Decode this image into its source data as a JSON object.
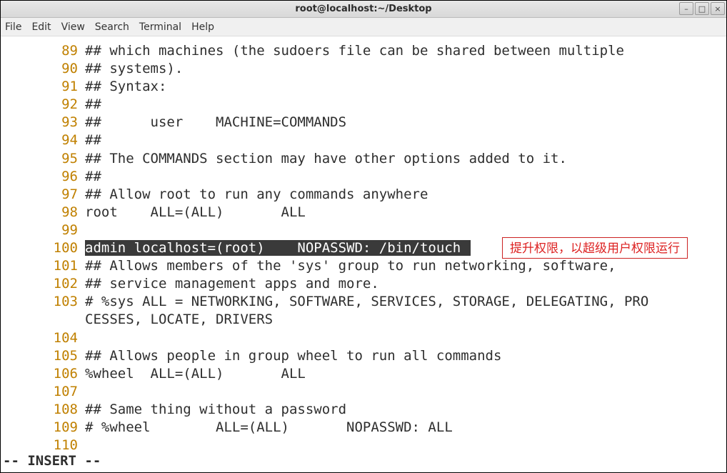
{
  "window": {
    "title": "root@localhost:~/Desktop",
    "minimize": "–",
    "maximize": "□",
    "close": "×"
  },
  "menu": {
    "file": "File",
    "edit": "Edit",
    "view": "View",
    "search": "Search",
    "terminal": "Terminal",
    "help": "Help"
  },
  "lines": {
    "n89": "89",
    "t89": "## which machines (the sudoers file can be shared between multiple",
    "n90": "90",
    "t90": "## systems).",
    "n91": "91",
    "t91": "## Syntax:",
    "n92": "92",
    "t92": "##",
    "n93": "93",
    "t93": "##      user    MACHINE=COMMANDS",
    "n94": "94",
    "t94": "##",
    "n95": "95",
    "t95": "## The COMMANDS section may have other options added to it.",
    "n96": "96",
    "t96": "##",
    "n97": "97",
    "t97": "## Allow root to run any commands anywhere",
    "n98": "98",
    "t98": "root    ALL=(ALL)       ALL",
    "n99": "99",
    "t99": "",
    "n100": "100",
    "t100": "admin localhost=(root)    NOPASSWD: /bin/touch ",
    "n101": "101",
    "t101": "## Allows members of the 'sys' group to run networking, software,",
    "n102": "102",
    "t102": "## service management apps and more.",
    "n103": "103",
    "t103a": "# %sys ALL = NETWORKING, SOFTWARE, SERVICES, STORAGE, DELEGATING, PRO",
    "t103b": "CESSES, LOCATE, DRIVERS",
    "n104": "104",
    "t104": "",
    "n105": "105",
    "t105": "## Allows people in group wheel to run all commands",
    "n106": "106",
    "t106": "%wheel  ALL=(ALL)       ALL",
    "n107": "107",
    "t107": "",
    "n108": "108",
    "t108": "## Same thing without a password",
    "n109": "109",
    "t109": "# %wheel        ALL=(ALL)       NOPASSWD: ALL",
    "n110": "110",
    "t110": ""
  },
  "annotation": "提升权限，以超级用户权限运行",
  "status": "-- INSERT --"
}
